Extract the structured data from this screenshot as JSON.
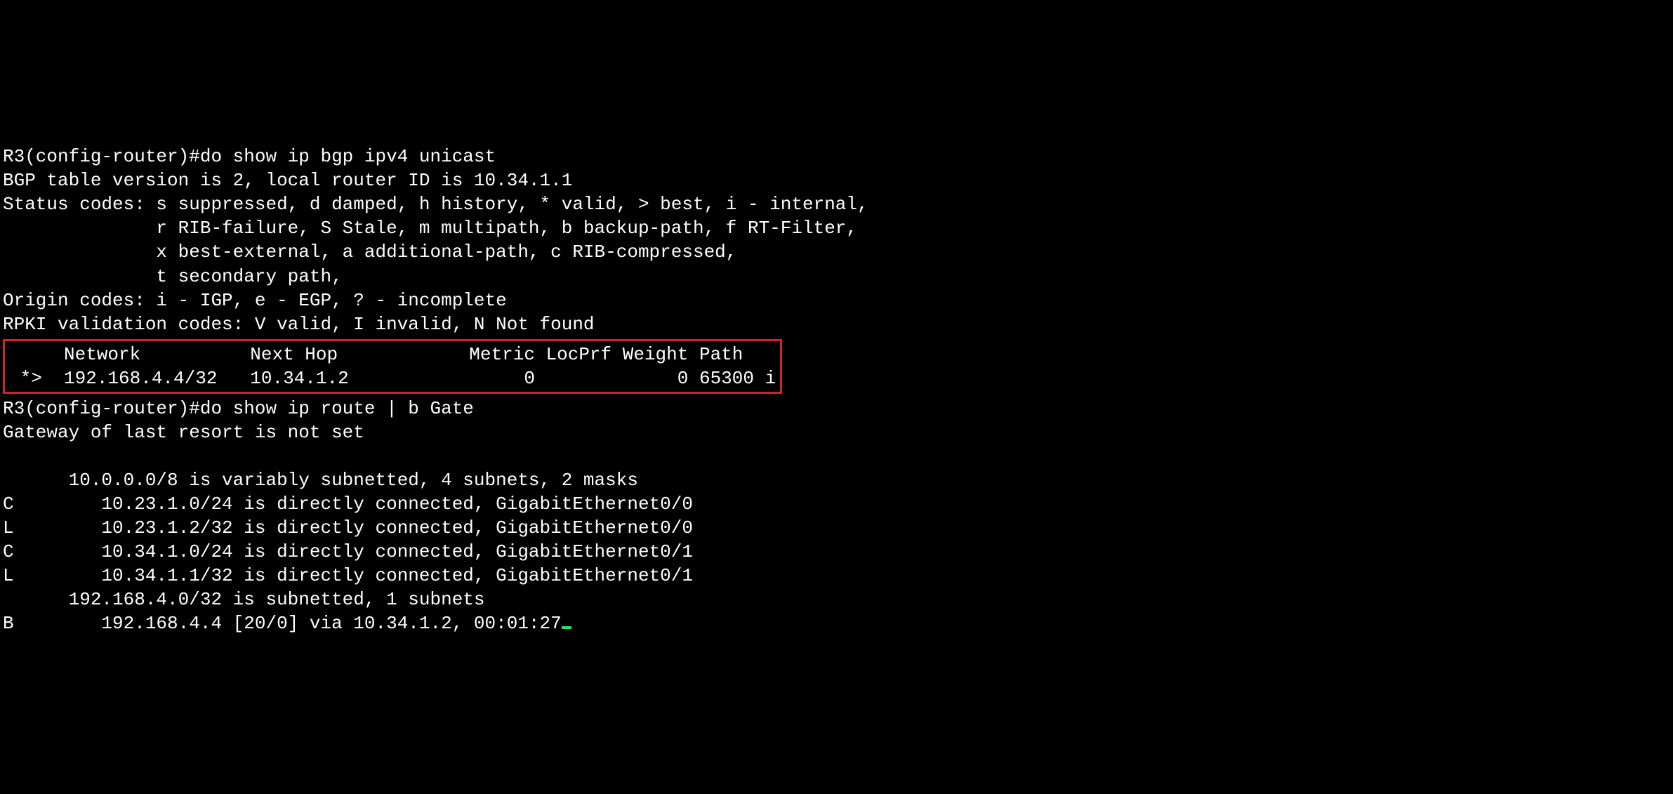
{
  "l1": "R3(config-router)#do show ip bgp ipv4 unicast",
  "l2": "BGP table version is 2, local router ID is 10.34.1.1",
  "l3": "Status codes: s suppressed, d damped, h history, * valid, > best, i - internal,",
  "l4": "              r RIB-failure, S Stale, m multipath, b backup-path, f RT-Filter,",
  "l5": "              x best-external, a additional-path, c RIB-compressed,",
  "l6": "              t secondary path,",
  "l7": "Origin codes: i - IGP, e - EGP, ? - incomplete",
  "l8": "RPKI validation codes: V valid, I invalid, N Not found",
  "bgp_header": "     Network          Next Hop            Metric LocPrf Weight Path",
  "bgp_row": " *>  192.168.4.4/32   10.34.1.2                0             0 65300 i",
  "bgp_table": {
    "columns": [
      "Network",
      "Next Hop",
      "Metric",
      "LocPrf",
      "Weight",
      "Path"
    ],
    "rows": [
      {
        "status": "*>",
        "network": "192.168.4.4/32",
        "next_hop": "10.34.1.2",
        "metric": "0",
        "locprf": "",
        "weight": "0",
        "path": "65300 i"
      }
    ]
  },
  "l9": "R3(config-router)#do show ip route | b Gate",
  "l10": "Gateway of last resort is not set",
  "l11": "",
  "l12": "      10.0.0.0/8 is variably subnetted, 4 subnets, 2 masks",
  "l13": "C        10.23.1.0/24 is directly connected, GigabitEthernet0/0",
  "l14": "L        10.23.1.2/32 is directly connected, GigabitEthernet0/0",
  "l15": "C        10.34.1.0/24 is directly connected, GigabitEthernet0/1",
  "l16": "L        10.34.1.1/32 is directly connected, GigabitEthernet0/1",
  "l17": "      192.168.4.0/32 is subnetted, 1 subnets",
  "l18": "B        192.168.4.4 [20/0] via 10.34.1.2, 00:01:27",
  "route_table": {
    "summaries": [
      "10.0.0.0/8 is variably subnetted, 4 subnets, 2 masks",
      "192.168.4.0/32 is subnetted, 1 subnets"
    ],
    "routes": [
      {
        "code": "C",
        "prefix": "10.23.1.0/24",
        "detail": "is directly connected, GigabitEthernet0/0"
      },
      {
        "code": "L",
        "prefix": "10.23.1.2/32",
        "detail": "is directly connected, GigabitEthernet0/0"
      },
      {
        "code": "C",
        "prefix": "10.34.1.0/24",
        "detail": "is directly connected, GigabitEthernet0/1"
      },
      {
        "code": "L",
        "prefix": "10.34.1.1/32",
        "detail": "is directly connected, GigabitEthernet0/1"
      },
      {
        "code": "B",
        "prefix": "192.168.4.4",
        "detail": "[20/0] via 10.34.1.2, 00:01:27"
      }
    ]
  }
}
